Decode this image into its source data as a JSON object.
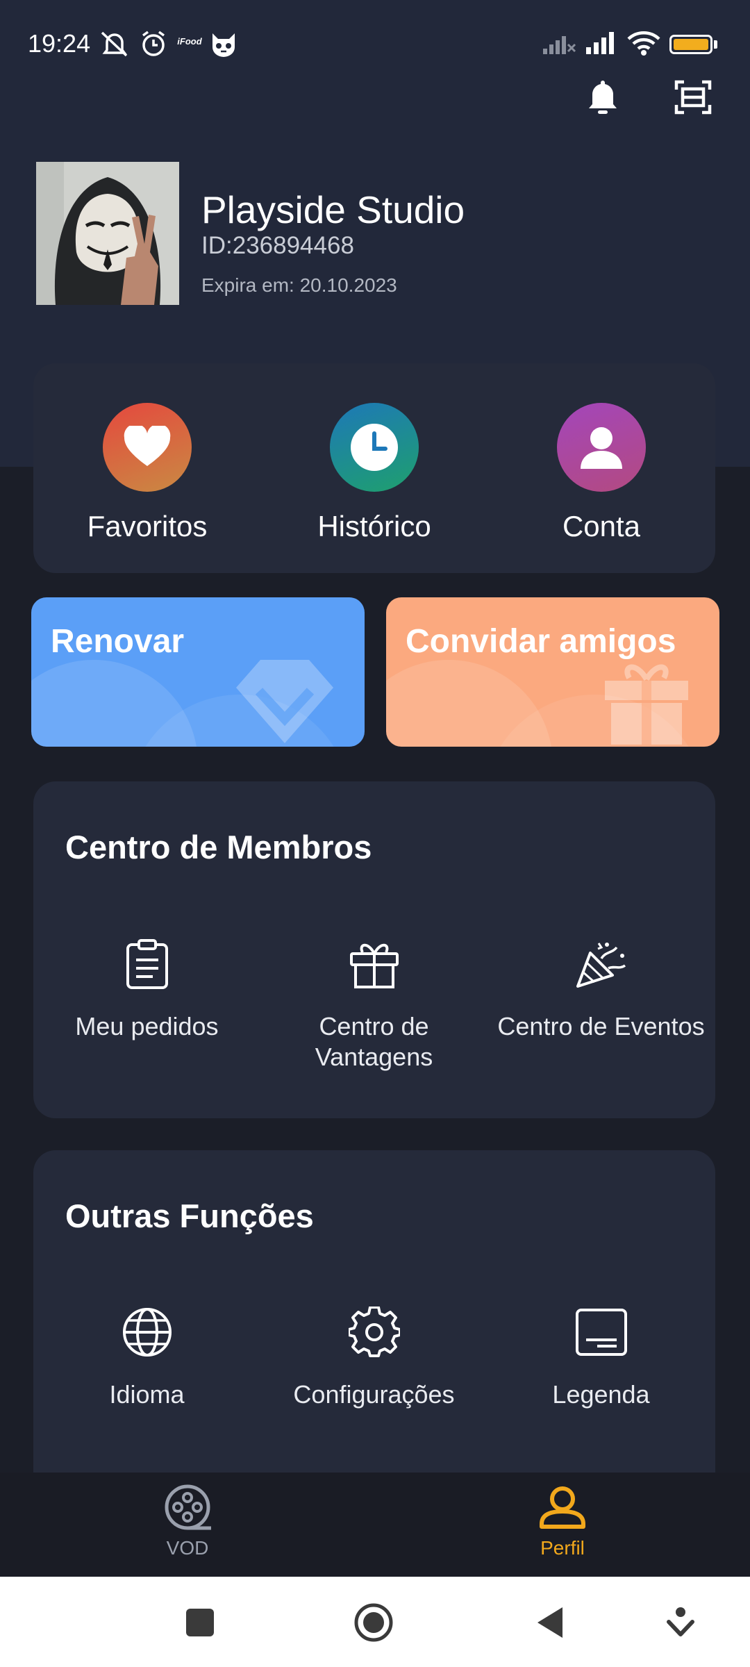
{
  "status_bar": {
    "time": "19:24",
    "left_icons": [
      "mute-icon",
      "alarm-icon",
      "ifood-icon",
      "cat-app-icon"
    ],
    "ifood_text": "iFood",
    "right_icons": [
      "signal-off-icon",
      "signal-icon",
      "wifi-icon",
      "battery-icon"
    ],
    "battery_color": "#f2ad1e"
  },
  "header": {
    "actions": [
      "bell-icon",
      "scan-icon"
    ]
  },
  "profile": {
    "name": "Playside Studio",
    "id": "ID:236894468",
    "expiry": "Expira em: 20.10.2023"
  },
  "quick_actions": [
    {
      "label": "Favoritos",
      "icon": "heart-icon"
    },
    {
      "label": "Histórico",
      "icon": "clock-icon"
    },
    {
      "label": "Conta",
      "icon": "user-icon"
    }
  ],
  "promos": [
    {
      "title": "Renovar",
      "icon": "diamond-icon",
      "color": "#5b9ff7"
    },
    {
      "title": "Convidar amigos",
      "icon": "gift-icon",
      "color": "#fba97f"
    }
  ],
  "member_center": {
    "title": "Centro de Membros",
    "items": [
      {
        "label": "Meu pedidos",
        "icon": "clipboard-icon"
      },
      {
        "label": "Centro de Vantagens",
        "icon": "gift-box-icon"
      },
      {
        "label": "Centro de Eventos",
        "icon": "party-popper-icon"
      }
    ]
  },
  "other_functions": {
    "title": "Outras Funções",
    "items": [
      {
        "label": "Idioma",
        "icon": "globe-icon"
      },
      {
        "label": "Configurações",
        "icon": "gear-icon"
      },
      {
        "label": "Legenda",
        "icon": "subtitle-icon"
      }
    ]
  },
  "bottom_nav": {
    "active_color": "#f2a81c",
    "items": [
      {
        "label": "VOD",
        "icon": "film-reel-icon",
        "active": false
      },
      {
        "label": "Perfil",
        "icon": "profile-icon",
        "active": true
      }
    ]
  },
  "system_nav": [
    "recents-icon",
    "home-icon",
    "back-icon",
    "dropdown-icon"
  ]
}
